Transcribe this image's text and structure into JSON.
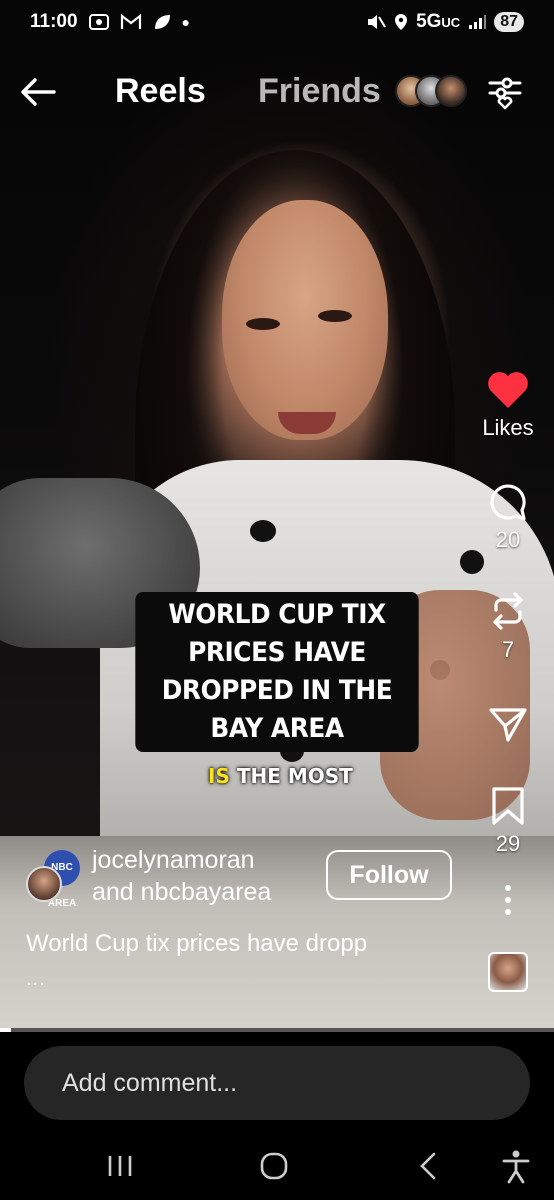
{
  "status_bar": {
    "time": "11:00",
    "network": "5G",
    "network_suffix": "UC",
    "battery": "87"
  },
  "header": {
    "tabs": [
      {
        "label": "Reels",
        "active": true
      },
      {
        "label": "Friends",
        "active": false
      }
    ]
  },
  "video": {
    "caption": "WORLD CUP TIX PRICES HAVE DROPPED IN THE BAY AREA",
    "subtitle_highlight": "IS",
    "subtitle_rest": "THE MOST"
  },
  "actions": {
    "like_label": "Likes",
    "comment_count": "20",
    "repost_count": "7",
    "save_count": "29",
    "like_color": "#ff3040"
  },
  "author": {
    "brand_badge": "NBC AREA",
    "username": "jocelynamoran",
    "collaborator_prefix": "and",
    "collaborator": "nbcbayarea",
    "follow_label": "Follow"
  },
  "description": {
    "text": "World Cup tix prices have dropp",
    "more": "..."
  },
  "comment": {
    "placeholder": "Add comment..."
  },
  "colors": {
    "accent_like": "#ff3040",
    "caption_bg": "#0b0b0b",
    "subtitle_highlight": "#ffe31a"
  }
}
